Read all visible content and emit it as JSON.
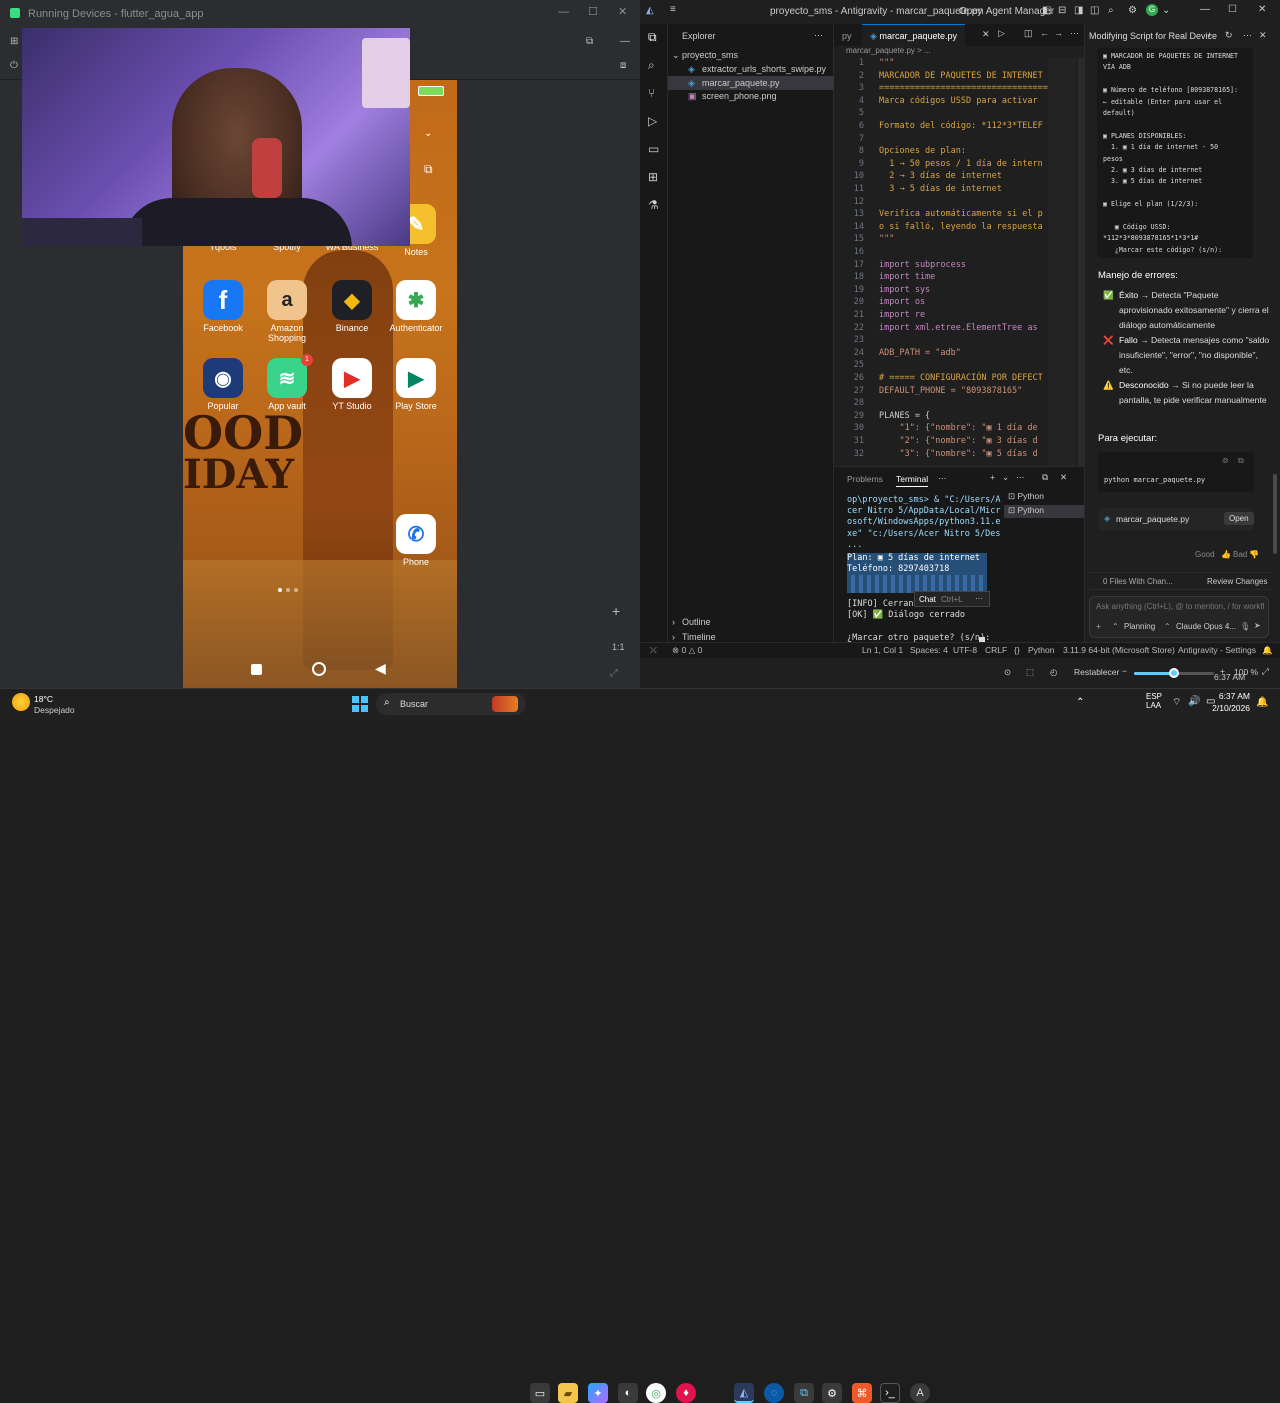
{
  "left_window": {
    "title": "Running Devices - flutter_agua_app"
  },
  "phone": {
    "top_row_apps": [
      "Tqools",
      "Spotify",
      "WA Business",
      "Notes"
    ],
    "apps_row1": [
      {
        "label": "Facebook",
        "icon": "facebook-icon",
        "color": "#1877f2",
        "glyph": "f"
      },
      {
        "label": "Amazon Shopping",
        "icon": "amazon-icon",
        "color": "#f2c48d",
        "glyph": "a"
      },
      {
        "label": "Binance",
        "icon": "binance-icon",
        "color": "#1e2026",
        "glyph": "◆"
      },
      {
        "label": "Authenticator",
        "icon": "authenticator-icon",
        "color": "#ffffff",
        "glyph": "✱"
      }
    ],
    "apps_row2": [
      {
        "label": "Popular",
        "icon": "popular-icon",
        "color": "#1c3b78",
        "glyph": "◉"
      },
      {
        "label": "App vault",
        "icon": "app-vault-icon",
        "color": "#3ad38a",
        "glyph": "≋"
      },
      {
        "label": "YT Studio",
        "icon": "yt-studio-icon",
        "color": "#ffffff",
        "glyph": "▶"
      },
      {
        "label": "Play Store",
        "icon": "play-store-icon",
        "color": "#ffffff",
        "glyph": "▶"
      }
    ],
    "badge_count": "1",
    "phone_app_label": "Phone",
    "wallpaper_text_1": "OOD",
    "wallpaper_text_2": "IDAY"
  },
  "ide": {
    "title": "proyecto_sms - Antigravity - marcar_paquete.py",
    "open_agent_manager": "Open Agent Manager",
    "explorer_label": "Explorer",
    "project_name": "proyecto_sms",
    "files": [
      {
        "name": "extractor_urls_shorts_swipe.py",
        "active": false
      },
      {
        "name": "marcar_paquete.py",
        "active": true
      },
      {
        "name": "screen_phone.png",
        "active": false
      }
    ],
    "outline_label": "Outline",
    "timeline_label": "Timeline",
    "tab_prev": "py",
    "tab_active": "marcar_paquete.py",
    "breadcrumb": "marcar_paquete.py > ...",
    "code_lines": [
      {
        "n": "1",
        "t": "\"\"\"",
        "c": "str"
      },
      {
        "n": "2",
        "t": "MARCADOR DE PAQUETES DE INTERNET",
        "c": "cm"
      },
      {
        "n": "3",
        "t": "=================================",
        "c": "cm"
      },
      {
        "n": "4",
        "t": "Marca códigos USSD para activar",
        "c": "cm"
      },
      {
        "n": "5",
        "t": "",
        "c": ""
      },
      {
        "n": "6",
        "t": "Formato del código: *112*3*TELEF",
        "c": "cm"
      },
      {
        "n": "7",
        "t": "",
        "c": ""
      },
      {
        "n": "8",
        "t": "Opciones de plan:",
        "c": "cm"
      },
      {
        "n": "9",
        "t": "  1 → 50 pesos / 1 día de intern",
        "c": "cm"
      },
      {
        "n": "10",
        "t": "  2 → 3 días de internet",
        "c": "cm"
      },
      {
        "n": "11",
        "t": "  3 → 5 días de internet",
        "c": "cm"
      },
      {
        "n": "12",
        "t": "",
        "c": ""
      },
      {
        "n": "13",
        "t": "Verifica automáticamente si el p",
        "c": "cm"
      },
      {
        "n": "14",
        "t": "o si falló, leyendo la respuesta",
        "c": "cm"
      },
      {
        "n": "15",
        "t": "\"\"\"",
        "c": "str"
      },
      {
        "n": "16",
        "t": "",
        "c": ""
      },
      {
        "n": "17",
        "t": "import subprocess",
        "c": "kw"
      },
      {
        "n": "18",
        "t": "import time",
        "c": "kw"
      },
      {
        "n": "19",
        "t": "import sys",
        "c": "kw"
      },
      {
        "n": "20",
        "t": "import os",
        "c": "kw"
      },
      {
        "n": "21",
        "t": "import re",
        "c": "kw"
      },
      {
        "n": "22",
        "t": "import xml.etree.ElementTree as",
        "c": "kw"
      },
      {
        "n": "23",
        "t": "",
        "c": ""
      },
      {
        "n": "24",
        "t": "ADB_PATH = \"adb\"",
        "c": "str"
      },
      {
        "n": "25",
        "t": "",
        "c": ""
      },
      {
        "n": "26",
        "t": "# ===== CONFIGURACIÓN POR DEFECT",
        "c": "cm"
      },
      {
        "n": "27",
        "t": "DEFAULT_PHONE = \"8093878165\"",
        "c": "str"
      },
      {
        "n": "28",
        "t": "",
        "c": ""
      },
      {
        "n": "29",
        "t": "PLANES = {",
        "c": ""
      },
      {
        "n": "30",
        "t": "    \"1\": {\"nombre\": \"▣ 1 día de",
        "c": "str"
      },
      {
        "n": "31",
        "t": "    \"2\": {\"nombre\": \"▣ 3 días d",
        "c": "str"
      },
      {
        "n": "32",
        "t": "    \"3\": {\"nombre\": \"▣ 5 días d",
        "c": "str"
      }
    ],
    "panel_tabs": [
      "Problems",
      "Terminal"
    ],
    "terminal_lines": [
      "op\\proyecto_sms> & \"C:/Users/A",
      "cer Nitro 5/AppData/Local/Micr",
      "osoft/WindowsApps/python3.11.e",
      "xe\" \"c:/Users/Acer Nitro 5/Des",
      "..."
    ],
    "terminal_selected": [
      "Plan: ▣ 5 días de internet",
      "Teléfono: 8297403718"
    ],
    "terminal_after": [
      "[INFO] Cerrand",
      "[OK] ✅ Diálogo cerrado",
      "",
      "¿Marcar otro paquete? (s/n):"
    ],
    "terminal_sessions": [
      "Python",
      "Python"
    ],
    "chat_tooltip": "Chat",
    "chat_shortcut": "Ctrl+L",
    "status": {
      "errors": "0",
      "warnings": "0",
      "position": "Ln 1, Col 1",
      "spaces": "Spaces: 4",
      "encoding": "UTF-8",
      "eol": "CRLF",
      "language": "Python",
      "interpreter": "3.11.9 64-bit (Microsoft Store)",
      "settings": "Antigravity - Settings"
    },
    "zoom": {
      "reset_label": "Restablecer",
      "percent": "100 %",
      "level": 0.5
    }
  },
  "agent": {
    "title": "Modifying Script for Real Device",
    "preview_lines": [
      "▣ MARCADOR DE PAQUETES DE INTERNET",
      "VÍA ADB",
      "",
      "▣ Número de teléfono [8093878165]:",
      "← editable (Enter para usar el",
      "default)",
      "",
      "▣ PLANES DISPONIBLES:",
      "  1. ▣ 1 día de internet - 50",
      "pesos",
      "  2. ▣ 3 días de internet",
      "  3. ▣ 5 días de internet",
      "",
      "▣ Elige el plan (1/2/3):",
      "",
      "   ▣ Código USSD:",
      "*112*3*8093878165*1*3*1#",
      "   ¿Marcar este código? (s/n):"
    ],
    "error_heading": "Manejo de errores:",
    "bullets": [
      {
        "icon": "✅",
        "title": "Éxito",
        "text": "→ Detecta \"Paquete aprovisionado exitosamente\" y cierra el diálogo automáticamente"
      },
      {
        "icon": "❌",
        "title": "Fallo",
        "text": "→ Detecta mensajes como \"saldo insuficiente\", \"error\", \"no disponible\", etc."
      },
      {
        "icon": "⚠️",
        "title": "Desconocido",
        "text": "→ Si no puede leer la pantalla, te pide verificar manualmente"
      }
    ],
    "run_heading": "Para ejecutar:",
    "run_command": "python marcar_paquete.py",
    "file_chip": "marcar_paquete.py",
    "open_button": "Open",
    "good_label": "Good",
    "bad_label": "Bad",
    "files_changed": "0 Files With Chan...",
    "review_changes": "Review Changes",
    "ask_placeholder": "Ask anything (Ctrl+L), @ to mention, / for workfl",
    "mode_label": "Planning",
    "model_label": "Claude Opus 4..."
  },
  "taskbar": {
    "weather_temp": "18°C",
    "weather_desc": "Despejado",
    "search_label": "Buscar",
    "lang_top": "ESP",
    "lang_bottom": "LAA",
    "time": "6:37 AM",
    "date": "2/10/2026",
    "notify_time": "6:37 AM"
  }
}
